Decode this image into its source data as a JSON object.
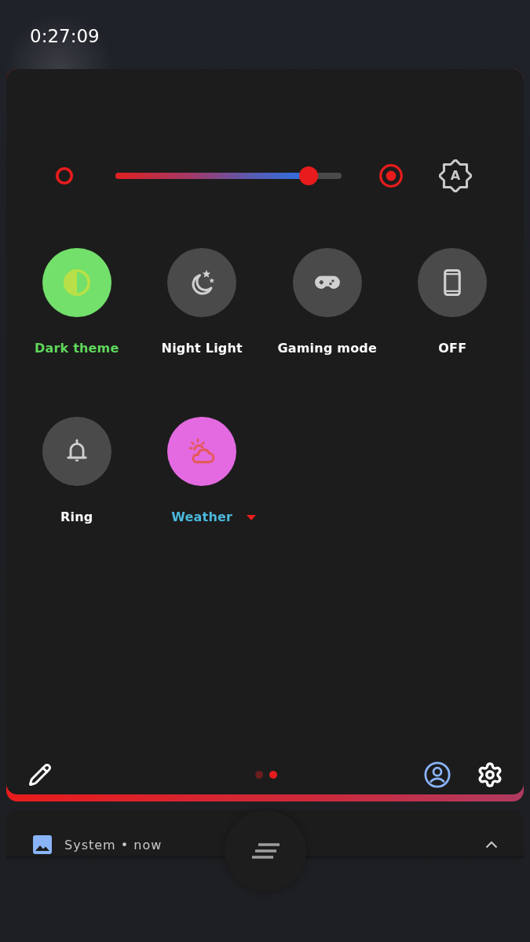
{
  "status_bar": {
    "time": "0:27:09"
  },
  "brightness": {
    "level": 0.855,
    "auto_label": "A"
  },
  "tiles": [
    {
      "label": {
        "text": "Dark theme",
        "color": "#5fd85a"
      },
      "on": true,
      "color": "#72e06a",
      "dropdown": false
    },
    {
      "label": {
        "text": "Night Light",
        "color": "#ffffff"
      },
      "on": false,
      "dropdown": false
    },
    {
      "label": {
        "text": "Gaming mode",
        "color": "#ffffff"
      },
      "on": false,
      "dropdown": false
    },
    {
      "label": {
        "text": "OFF",
        "color": "#ffffff"
      },
      "on": false,
      "dropdown": false
    },
    {
      "label": {
        "text": "Ring",
        "color": "#ffffff"
      },
      "on": false,
      "dropdown": false
    },
    {
      "label": {
        "text": "Weather",
        "color": "#4bb8dc"
      },
      "on": true,
      "color": "#e36ae0",
      "dropdown": true
    }
  ],
  "pages": [
    {
      "selected": false
    },
    {
      "selected": true
    }
  ],
  "notification": {
    "header": "System • now"
  }
}
